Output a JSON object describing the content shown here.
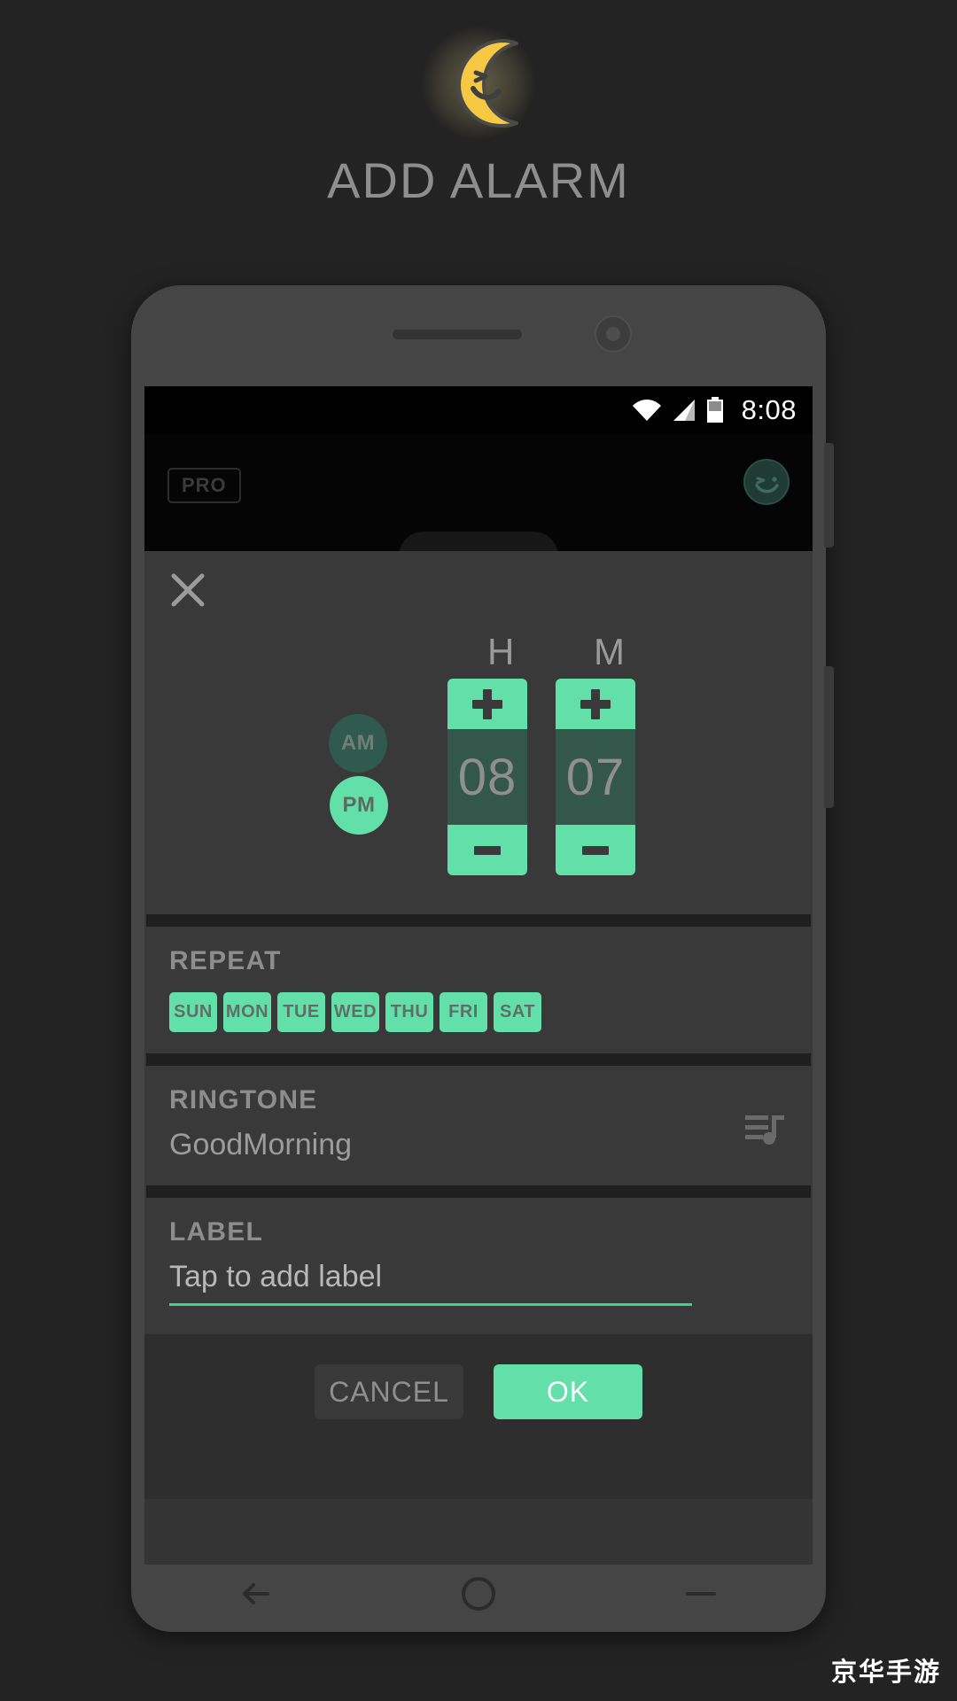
{
  "header": {
    "logo_icon": "crescent-moon-face-icon",
    "title": "ADD ALARM"
  },
  "phone": {
    "status_bar": {
      "wifi_icon": "wifi-icon",
      "signal_icon": "cell-signal-icon",
      "battery_icon": "battery-icon",
      "clock": "8:08"
    },
    "app_bar": {
      "pro_badge": "PRO",
      "smiley_icon": "smiley-face-icon"
    },
    "nav_bar": {
      "back_icon": "back-arrow-icon",
      "home_icon": "home-circle-icon",
      "recents_icon": "recents-dash-icon"
    }
  },
  "dialog": {
    "close_icon": "close-x-icon",
    "time_picker": {
      "hour_label": "H",
      "minute_label": "M",
      "am_label": "AM",
      "pm_label": "PM",
      "selected_meridiem": "PM",
      "hour_value": "08",
      "minute_value": "07",
      "hour_increment_icon": "plus-icon",
      "hour_decrement_icon": "minus-icon",
      "minute_increment_icon": "plus-icon",
      "minute_decrement_icon": "minus-icon"
    },
    "repeat": {
      "title": "REPEAT",
      "days": [
        {
          "label": "SUN",
          "selected": true
        },
        {
          "label": "MON",
          "selected": true
        },
        {
          "label": "TUE",
          "selected": true
        },
        {
          "label": "WED",
          "selected": true
        },
        {
          "label": "THU",
          "selected": true
        },
        {
          "label": "FRI",
          "selected": true
        },
        {
          "label": "SAT",
          "selected": true
        }
      ]
    },
    "ringtone": {
      "title": "RINGTONE",
      "value": "GoodMorning",
      "icon": "playlist-music-icon"
    },
    "label": {
      "title": "LABEL",
      "placeholder": "Tap to add label",
      "value": ""
    },
    "actions": {
      "cancel_label": "CANCEL",
      "ok_label": "OK"
    }
  },
  "watermark": "京华手游",
  "colors": {
    "page_background": "#232323",
    "accent_mint": "#63dfaa",
    "accent_dark_teal": "#33574a",
    "dialog_background": "#393939",
    "moon_yellow": "#f7c844",
    "text_gray": "#8d8d8d"
  }
}
